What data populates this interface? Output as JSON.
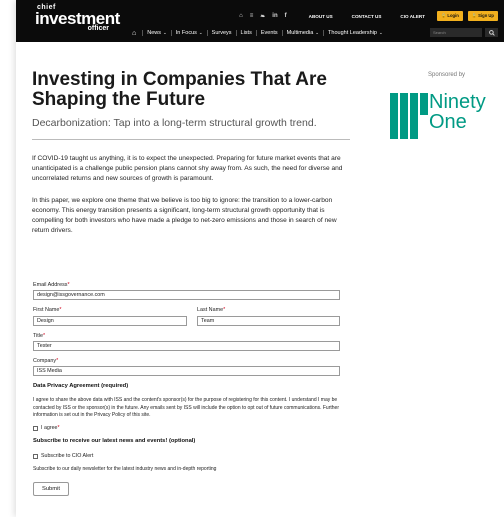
{
  "header": {
    "logo": {
      "line1": "chief",
      "line2": "investment",
      "line3": "officer"
    },
    "util_links": [
      "ABOUT US",
      "CONTACT US",
      "CIO ALERT"
    ],
    "login_label": "🔒 Login",
    "signup_label": "🔒 Sign Up",
    "social_icons": [
      "rss",
      "twitter",
      "linkedin",
      "facebook"
    ],
    "nav": [
      {
        "label": "News",
        "dropdown": true
      },
      {
        "label": "In Focus",
        "dropdown": true
      },
      {
        "label": "Surveys",
        "dropdown": false
      },
      {
        "label": "Lists",
        "dropdown": false
      },
      {
        "label": "Events",
        "dropdown": false
      },
      {
        "label": "Multimedia",
        "dropdown": true
      },
      {
        "label": "Thought Leadership",
        "dropdown": true
      }
    ],
    "search_placeholder": "Search"
  },
  "article": {
    "title": "Investing in Companies That Are Shaping the Future",
    "subtitle": "Decarbonization: Tap into a long-term structural growth trend.",
    "paragraph1": "If COVID-19 taught us anything, it is to expect the unexpected. Preparing for future market events that are unanticipated is a challenge public pension plans cannot shy away from. As such, the need for diverse and uncorrelated returns and new sources of growth is paramount.",
    "paragraph2": "In this paper, we explore one theme that we believe is too big to ignore: the transition to a lower-carbon economy. This energy transition presents a significant, long-term structural growth opportunity that is compelling for both investors who have made a pledge to net-zero emissions and those in search of new return drivers."
  },
  "sponsor": {
    "label": "Sponsored by",
    "name_line1": "Ninety",
    "name_line2": "One",
    "color": "#009a84"
  },
  "form": {
    "email_label": "Email Address",
    "email_value": "design@issgovernance.com",
    "first_name_label": "First Name",
    "first_name_value": "Design",
    "last_name_label": "Last Name",
    "last_name_value": "Team",
    "title_label": "Title",
    "title_value": "Tester",
    "company_label": "Company",
    "company_value": "ISS Media",
    "required_mark": "*",
    "privacy_heading": "Data Privacy Agreement (required)",
    "privacy_text": "I agree to share the above data with ISS and the content's sponsor(s) for the purpose of registering for this content. I understand I may be contacted by ISS or the sponsor(s) in the future. Any emails sent by ISS will include the option to opt out of future communications. Further information is set out in the Privacy Policy of this site.",
    "agree_label": "I agree",
    "subscribe_heading": "Subscribe to receive our latest news and events! (optional)",
    "cio_alert_label": "Subscribe to CIO Alert",
    "newsletter_text": "Subscribe to our daily newsletter for the latest industry news and in-depth reporting",
    "submit_label": "Submit"
  }
}
